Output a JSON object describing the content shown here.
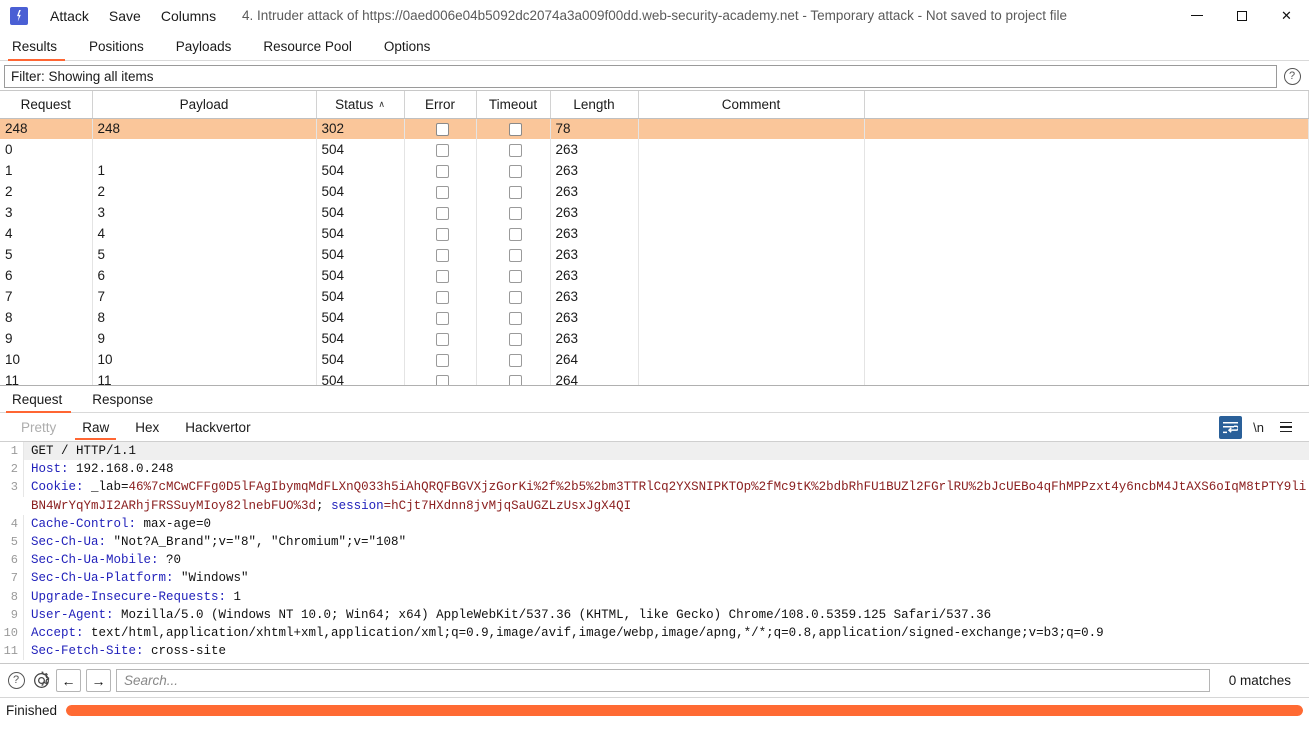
{
  "window": {
    "title": "4. Intruder attack of https://0aed006e04b5092dc2074a3a009f00dd.web-security-academy.net - Temporary attack - Not saved to project file",
    "menu": [
      {
        "label": "Attack",
        "name": "attack-menu"
      },
      {
        "label": "Save",
        "name": "save-menu"
      },
      {
        "label": "Columns",
        "name": "columns-menu"
      }
    ],
    "controls": {
      "minimize": "minimize-button",
      "maximize": "maximize-button",
      "close": "close-button"
    }
  },
  "tabs": {
    "items": [
      {
        "label": "Results",
        "active": true
      },
      {
        "label": "Positions",
        "active": false
      },
      {
        "label": "Payloads",
        "active": false
      },
      {
        "label": "Resource Pool",
        "active": false
      },
      {
        "label": "Options",
        "active": false
      }
    ]
  },
  "filter": {
    "text": "Filter: Showing all items",
    "help_glyph": "?"
  },
  "results_table": {
    "columns": [
      {
        "label": "Request",
        "sorted": false
      },
      {
        "label": "Payload",
        "sorted": false
      },
      {
        "label": "Status",
        "sorted": true,
        "sort_caret": "∧"
      },
      {
        "label": "Error",
        "sorted": false
      },
      {
        "label": "Timeout",
        "sorted": false
      },
      {
        "label": "Length",
        "sorted": false
      },
      {
        "label": "Comment",
        "sorted": false
      }
    ],
    "rows": [
      {
        "request": "248",
        "payload": "248",
        "status": "302",
        "error": false,
        "timeout": false,
        "length": "78",
        "comment": "",
        "selected": true
      },
      {
        "request": "0",
        "payload": "",
        "status": "504",
        "error": false,
        "timeout": false,
        "length": "263",
        "comment": "",
        "selected": false
      },
      {
        "request": "1",
        "payload": "1",
        "status": "504",
        "error": false,
        "timeout": false,
        "length": "263",
        "comment": "",
        "selected": false
      },
      {
        "request": "2",
        "payload": "2",
        "status": "504",
        "error": false,
        "timeout": false,
        "length": "263",
        "comment": "",
        "selected": false
      },
      {
        "request": "3",
        "payload": "3",
        "status": "504",
        "error": false,
        "timeout": false,
        "length": "263",
        "comment": "",
        "selected": false
      },
      {
        "request": "4",
        "payload": "4",
        "status": "504",
        "error": false,
        "timeout": false,
        "length": "263",
        "comment": "",
        "selected": false
      },
      {
        "request": "5",
        "payload": "5",
        "status": "504",
        "error": false,
        "timeout": false,
        "length": "263",
        "comment": "",
        "selected": false
      },
      {
        "request": "6",
        "payload": "6",
        "status": "504",
        "error": false,
        "timeout": false,
        "length": "263",
        "comment": "",
        "selected": false
      },
      {
        "request": "7",
        "payload": "7",
        "status": "504",
        "error": false,
        "timeout": false,
        "length": "263",
        "comment": "",
        "selected": false
      },
      {
        "request": "8",
        "payload": "8",
        "status": "504",
        "error": false,
        "timeout": false,
        "length": "263",
        "comment": "",
        "selected": false
      },
      {
        "request": "9",
        "payload": "9",
        "status": "504",
        "error": false,
        "timeout": false,
        "length": "263",
        "comment": "",
        "selected": false
      },
      {
        "request": "10",
        "payload": "10",
        "status": "504",
        "error": false,
        "timeout": false,
        "length": "264",
        "comment": "",
        "selected": false
      },
      {
        "request": "11",
        "payload": "11",
        "status": "504",
        "error": false,
        "timeout": false,
        "length": "264",
        "comment": "",
        "selected": false
      }
    ]
  },
  "message_tabs": {
    "items": [
      {
        "label": "Request",
        "active": true
      },
      {
        "label": "Response",
        "active": false
      }
    ]
  },
  "view_tabs": {
    "items": [
      {
        "label": "Pretty",
        "active": false,
        "disabled": true
      },
      {
        "label": "Raw",
        "active": true,
        "disabled": false
      },
      {
        "label": "Hex",
        "active": false,
        "disabled": false
      },
      {
        "label": "Hackvertor",
        "active": false,
        "disabled": false
      }
    ],
    "tools": {
      "word_wrap": "word-wrap-toggle",
      "newline_label": "\\n",
      "menu": "editor-menu"
    }
  },
  "request": {
    "lines": [
      {
        "num": "1",
        "type": "plain",
        "text": "GET / HTTP/1.1",
        "highlight": true
      },
      {
        "num": "2",
        "type": "header",
        "name": "Host",
        "value": " 192.168.0.248"
      },
      {
        "num": "3",
        "type": "cookie",
        "name": "Cookie",
        "prefix": " _lab=",
        "cookie_value": "46%7cMCwCFFg0D5lFAgIbymqMdFLXnQ033h5iAhQRQFBGVXjzGorKi%2f%2b5%2bm3TTRlCq2YXSNIPKTOp%2fMc9tK%2bdbRhFU1BUZl2FGrlRU%2bJcUEBo4qFhMPPzxt4y6ncbM4JtAXS6oIqM8tPTY9liBN4WrYqYmJI2ARhjFRSSuyMIoy82lnebFUO%3d",
        "separator": "; ",
        "session_key": "session",
        "session_value": "=hCjt7HXdnn8jvMjqSaUGZLzUsxJgX4QI"
      },
      {
        "num": "4",
        "type": "header",
        "name": "Cache-Control",
        "value": " max-age=0"
      },
      {
        "num": "5",
        "type": "header",
        "name": "Sec-Ch-Ua",
        "value": " \"Not?A_Brand\";v=\"8\", \"Chromium\";v=\"108\""
      },
      {
        "num": "6",
        "type": "header",
        "name": "Sec-Ch-Ua-Mobile",
        "value": " ?0"
      },
      {
        "num": "7",
        "type": "header",
        "name": "Sec-Ch-Ua-Platform",
        "value": " \"Windows\""
      },
      {
        "num": "8",
        "type": "header",
        "name": "Upgrade-Insecure-Requests",
        "value": " 1"
      },
      {
        "num": "9",
        "type": "header",
        "name": "User-Agent",
        "value": " Mozilla/5.0 (Windows NT 10.0; Win64; x64) AppleWebKit/537.36 (KHTML, like Gecko) Chrome/108.0.5359.125 Safari/537.36"
      },
      {
        "num": "10",
        "type": "header",
        "name": "Accept",
        "value": " text/html,application/xhtml+xml,application/xml;q=0.9,image/avif,image/webp,image/apng,*/*;q=0.8,application/signed-exchange;v=b3;q=0.9"
      },
      {
        "num": "11",
        "type": "header",
        "name": "Sec-Fetch-Site",
        "value": " cross-site"
      }
    ]
  },
  "search": {
    "placeholder": "Search...",
    "value": "",
    "match_count": "0 matches",
    "back_glyph": "←",
    "forward_glyph": "→",
    "help_glyph": "?"
  },
  "status": {
    "text": "Finished",
    "progress_percent": 100
  },
  "colors": {
    "accent": "#ff6633",
    "selection": "#fac69a",
    "header_name": "#2222bb",
    "cookie_value": "#8b2020",
    "wrap_active": "#2a6099"
  }
}
